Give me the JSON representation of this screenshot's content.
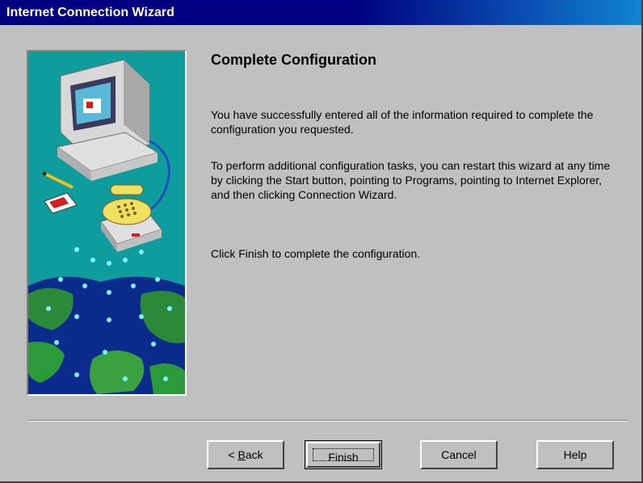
{
  "window": {
    "title": "Internet Connection Wizard"
  },
  "content": {
    "heading": "Complete Configuration",
    "paragraph1": "You have successfully entered all of the information required to complete the configuration you requested.",
    "paragraph2": "To perform additional configuration tasks, you can restart this wizard at any time by clicking the Start button, pointing to Programs, pointing to Internet Explorer, and then clicking Connection Wizard.",
    "paragraph3": "Click Finish to complete the configuration."
  },
  "buttons": {
    "back_prefix": "< ",
    "back_accel": "B",
    "back_rest": "ack",
    "finish": "Finish",
    "cancel": "Cancel",
    "help": "Help"
  },
  "colors": {
    "titlebar": "#000080",
    "dialog_bg": "#c0c0c0",
    "illustration_bg": "#0f9c9c"
  },
  "illustration": {
    "icon": "computer-phone-globe-illustration"
  }
}
